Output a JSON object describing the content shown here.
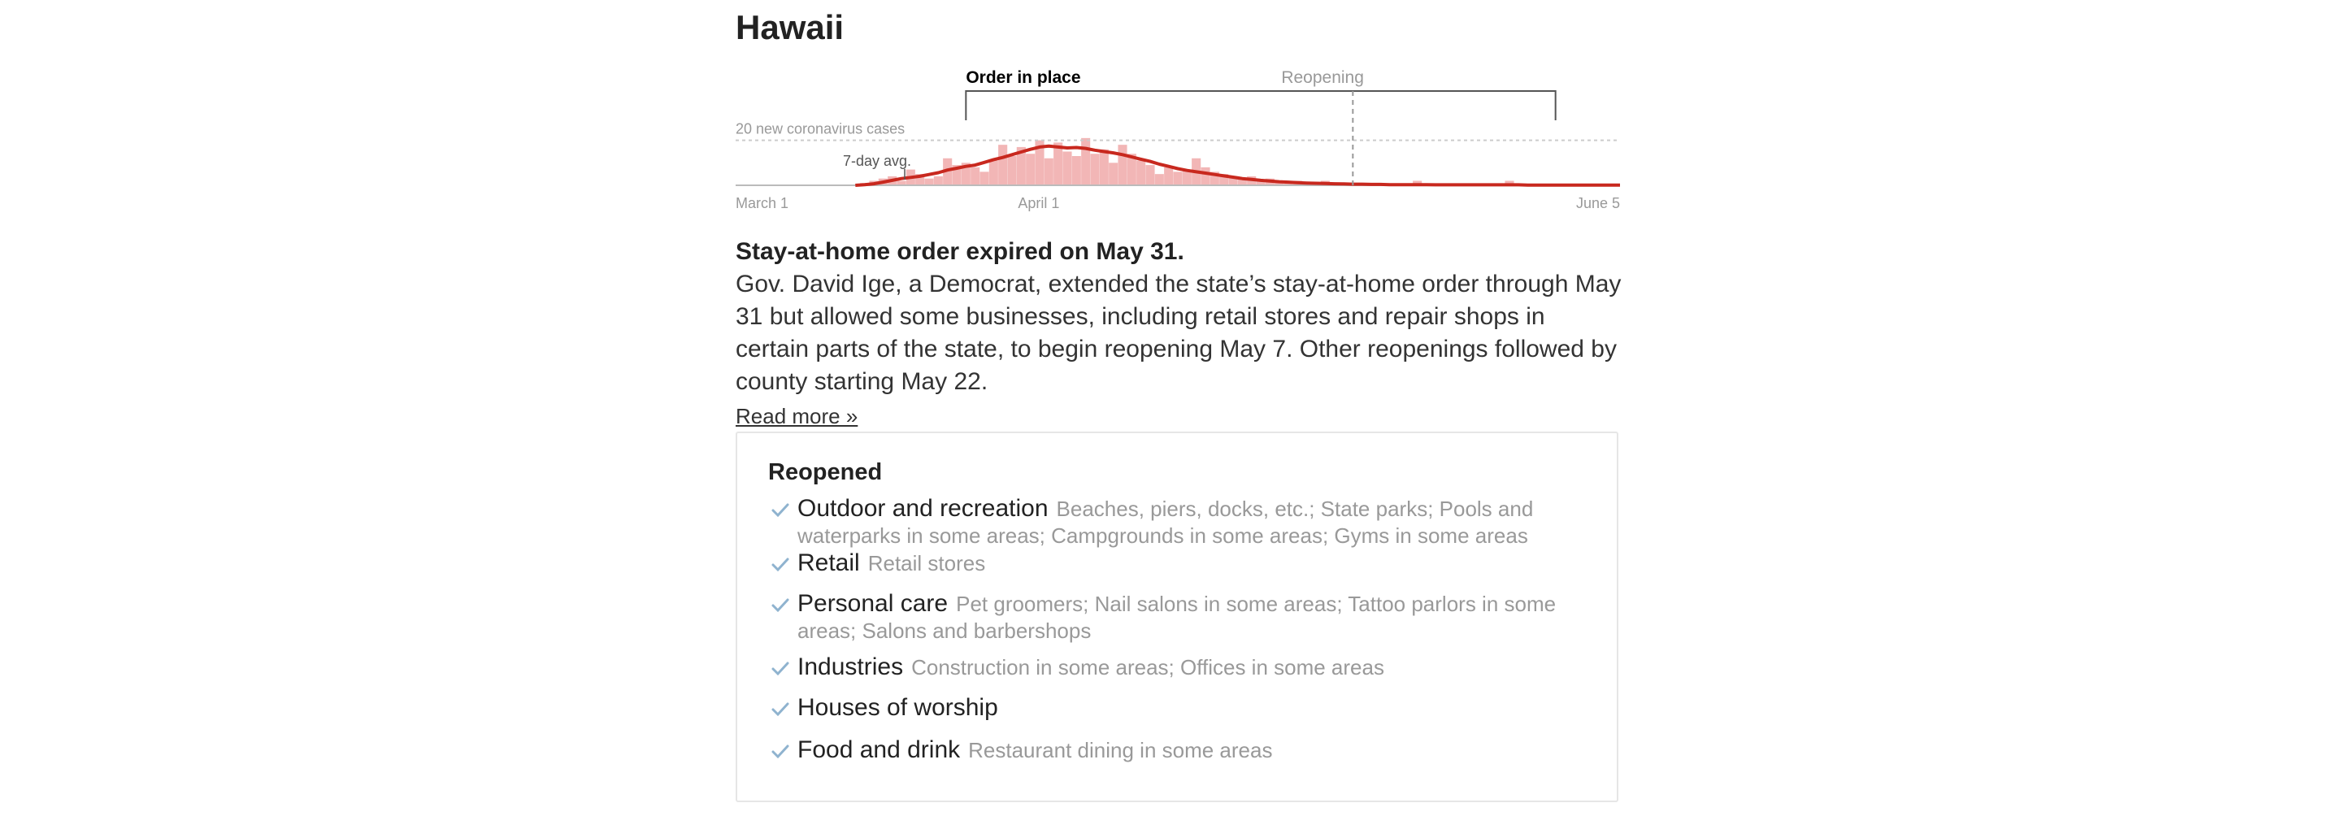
{
  "state": "Hawaii",
  "chart_data": {
    "type": "bar",
    "title": "",
    "annotations": {
      "order_label": "Order in place",
      "reopening_label": "Reopening",
      "cases_label": "20 new coronavirus cases",
      "avg_label": "7-day avg."
    },
    "x_ticks": [
      "March 1",
      "April 1",
      "June 5"
    ],
    "x_start": "March 1",
    "x_end": "June 5",
    "order_start_index": 25,
    "reopening_start_index": 67,
    "order_end_index": 89,
    "reference_value": 20,
    "ylim": [
      0,
      26
    ],
    "values": [
      0,
      0,
      0,
      0,
      0,
      0,
      0,
      0,
      0,
      0,
      0,
      0,
      0,
      0,
      1,
      2,
      3,
      4,
      2,
      7,
      5,
      3,
      4,
      12,
      9,
      10,
      8,
      6,
      11,
      18,
      13,
      17,
      14,
      20,
      12,
      19,
      15,
      13,
      21,
      14,
      16,
      10,
      18,
      14,
      11,
      9,
      5,
      8,
      6,
      7,
      12,
      8,
      6,
      5,
      4,
      3,
      4,
      2,
      3,
      2,
      1,
      2,
      1,
      1,
      2,
      1,
      1,
      0,
      1,
      1,
      0,
      0,
      0,
      0,
      2,
      0,
      0,
      0,
      0,
      0,
      0,
      0,
      0,
      0,
      2,
      0,
      0,
      0,
      0,
      0,
      0,
      0,
      0,
      0,
      0,
      0,
      0
    ],
    "series": [
      {
        "name": "7-day avg.",
        "values": [
          0,
          0,
          0,
          0,
          0,
          0,
          0,
          0,
          0,
          0,
          0,
          0,
          0,
          0,
          0.3,
          0.7,
          1.4,
          2.2,
          3.0,
          3.5,
          4.0,
          4.8,
          5.6,
          6.8,
          7.6,
          8.4,
          9.0,
          10.2,
          11.4,
          12.4,
          13.6,
          14.8,
          16.0,
          17.0,
          17.4,
          17.0,
          16.6,
          16.8,
          16.4,
          15.6,
          15.0,
          14.4,
          13.6,
          12.6,
          11.6,
          10.6,
          9.4,
          8.4,
          7.4,
          6.6,
          6.0,
          5.4,
          4.8,
          4.2,
          3.6,
          3.0,
          2.6,
          2.2,
          1.9,
          1.6,
          1.4,
          1.2,
          1.0,
          0.9,
          0.8,
          0.7,
          0.6,
          0.5,
          0.5,
          0.4,
          0.4,
          0.3,
          0.3,
          0.3,
          0.3,
          0.3,
          0.2,
          0.2,
          0.2,
          0.2,
          0.2,
          0.2,
          0.2,
          0.2,
          0.2,
          0.2,
          0.1,
          0.1,
          0.1,
          0.1,
          0.1,
          0.1,
          0.1,
          0.1,
          0.1,
          0.1,
          0.1
        ]
      }
    ],
    "colors": {
      "bars": "#f2b6b6",
      "avg_line": "#c8281e",
      "bracket": "#555555",
      "dashed": "#999999"
    }
  },
  "description": {
    "title": "Stay-at-home order expired on May 31.",
    "body": "Gov. David Ige, a Democrat, extended the state’s stay-at-home order through May 31 but allowed some businesses, including retail stores and repair shops in certain parts of the state, to begin reopening May 7. Other reopenings followed by county starting May 22.",
    "read_more": "Read more »"
  },
  "reopened": {
    "title": "Reopened",
    "check_color": "#8fb3cf",
    "items": [
      {
        "category": "Outdoor and recreation",
        "details": "Beaches, piers, docks, etc.; State parks; Pools and waterparks in some areas; Campgrounds in some areas; Gyms in some areas"
      },
      {
        "category": "Retail",
        "details": "Retail stores"
      },
      {
        "category": "Personal care",
        "details": "Pet groomers; Nail salons in some areas; Tattoo parlors in some areas; Salons and barbershops"
      },
      {
        "category": "Industries",
        "details": "Construction in some areas; Offices in some areas"
      },
      {
        "category": "Houses of worship",
        "details": ""
      },
      {
        "category": "Food and drink",
        "details": "Restaurant dining in some areas"
      }
    ]
  }
}
